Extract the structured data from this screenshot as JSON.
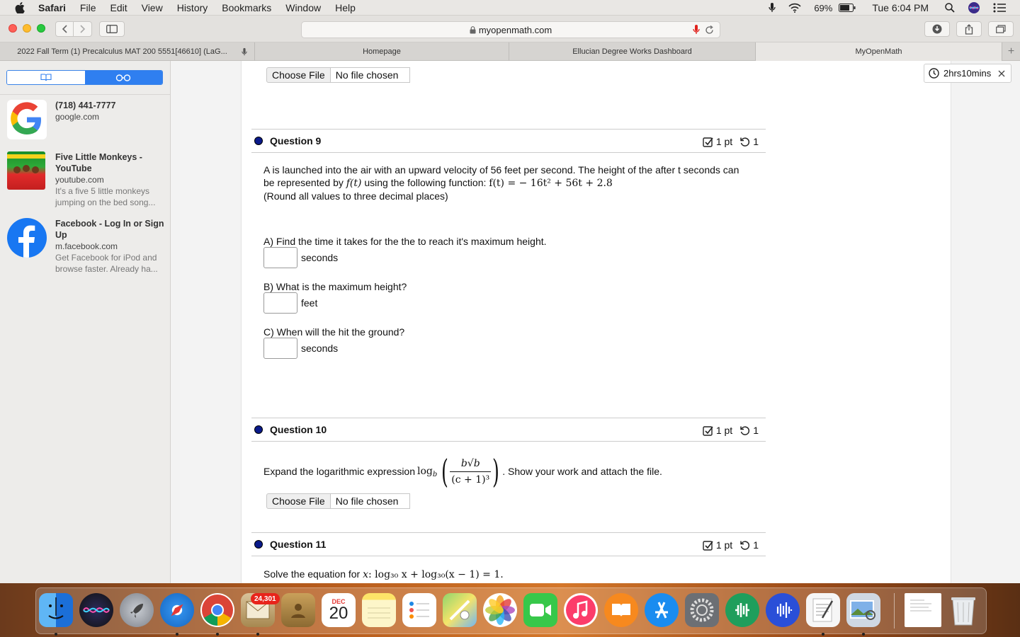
{
  "menubar": {
    "app": "Safari",
    "items": [
      "File",
      "Edit",
      "View",
      "History",
      "Bookmarks",
      "Window",
      "Help"
    ],
    "battery": "69%",
    "clock": "Tue 6:04 PM"
  },
  "toolbar": {
    "url": "myopenmath.com"
  },
  "tabs": [
    {
      "label": "2022 Fall Term (1) Precalculus MAT 200 5551[46610] (LaG..."
    },
    {
      "label": "Homepage"
    },
    {
      "label": "Ellucian Degree Works Dashboard"
    },
    {
      "label": "MyOpenMath"
    }
  ],
  "sidebar": {
    "items": [
      {
        "title": "(718) 441-7777",
        "domain": "google.com",
        "desc": ""
      },
      {
        "title": "Five Little Monkeys - YouTube",
        "domain": "youtube.com",
        "desc": "It's a five 5 little monkeys jumping on the bed song..."
      },
      {
        "title": "Facebook - Log In or Sign Up",
        "domain": "m.facebook.com",
        "desc": "Get Facebook for iPod and browse faster. Already ha..."
      }
    ]
  },
  "timer": {
    "label": "2hrs10mins"
  },
  "file_input": {
    "button": "Choose File",
    "status": "No file chosen"
  },
  "questions": {
    "q9": {
      "title": "Question 9",
      "points": "1 pt",
      "retries": "1",
      "text1": "A is launched into the air with an upward velocity of 56 feet per second. The height of the after t seconds can",
      "text2a": "be represented by ",
      "text2b": " using the following function: ",
      "ft": "f(t)",
      "func": "f(t) = − 16t² + 56t + 2.8",
      "text3": "(Round all values to three decimal places)",
      "partA": "A) Find the time it takes for the the to reach it's maximum height.",
      "unitA": "seconds",
      "partB": "B) What is the maximum height?",
      "unitB": "feet",
      "partC": "C) When will the hit the ground?",
      "unitC": "seconds"
    },
    "q10": {
      "title": "Question 10",
      "points": "1 pt",
      "retries": "1",
      "text_before": "Expand the logarithmic expression ",
      "log": "log",
      "base": "b",
      "numerator": "b√b",
      "denominator": "(c + 1)³",
      "text_after": ". Show your work and attach the file."
    },
    "q11": {
      "title": "Question 11",
      "points": "1 pt",
      "retries": "1",
      "text_before": "Solve the equation for ",
      "var": "x",
      "equation": ": log₃₀ x + log₃₀(x − 1) = 1."
    }
  },
  "dock": {
    "badge": "24,301",
    "calendar_month": "DEC",
    "calendar_day": "20"
  }
}
